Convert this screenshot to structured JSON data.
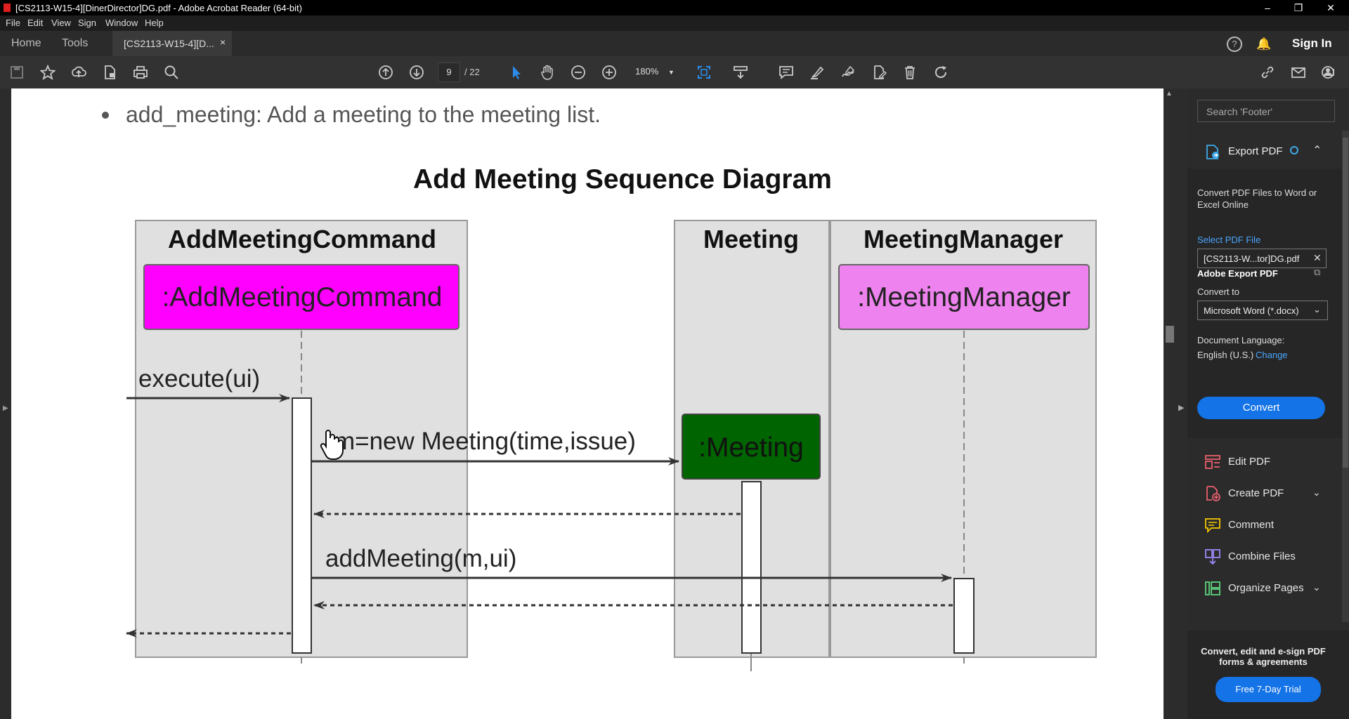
{
  "window": {
    "title": "[CS2113-W15-4][DinerDirector]DG.pdf - Adobe Acrobat Reader (64-bit)"
  },
  "menu": [
    "File",
    "Edit",
    "View",
    "Sign",
    "Window",
    "Help"
  ],
  "tabs": {
    "home": "Home",
    "tools": "Tools",
    "doc": "[CS2113-W15-4][D...",
    "close": "×",
    "signin": "Sign In",
    "help": "?"
  },
  "toolbar": {
    "page_current": "9",
    "page_total": "/ 22",
    "zoom": "180%",
    "icons": [
      "save-icon",
      "star-icon",
      "upload-icon",
      "file-icon",
      "print-icon",
      "search-icon",
      "page-up-icon",
      "page-down-icon",
      "select-icon",
      "hand-icon",
      "zoom-out-icon",
      "zoom-in-icon",
      "fit-icon",
      "scroll-icon",
      "comment-icon",
      "highlight-icon",
      "sign-icon",
      "edit-icon",
      "delete-icon",
      "rotate-icon",
      "link-icon",
      "email-icon",
      "share-icon"
    ]
  },
  "document": {
    "bullet_text": "add_meeting: Add a meeting to the meeting list.",
    "diagram": {
      "title": "Add Meeting Sequence Diagram",
      "participants": [
        {
          "header": "AddMeetingCommand",
          "box": ":AddMeetingCommand",
          "color": "#ff00ff"
        },
        {
          "header": "Meeting",
          "box": ":Meeting",
          "color": "#006400"
        },
        {
          "header": "MeetingManager",
          "box": ":MeetingManager",
          "color": "#ee82ee"
        }
      ],
      "messages": [
        "execute(ui)",
        "m=new Meeting(time,issue)",
        "addMeeting(m,ui)"
      ]
    }
  },
  "right_pane": {
    "search_placeholder": "Search 'Footer'",
    "export_label": "Export PDF",
    "card_title": "Adobe Export PDF",
    "card_desc": "Convert PDF Files to Word or Excel Online",
    "select_file": "Select PDF File",
    "file_name": "[CS2113-W...tor]DG.pdf",
    "convert_to": "Convert to",
    "format": "Microsoft Word (*.docx)",
    "doc_lang_label": "Document Language:",
    "doc_lang": "English (U.S.)",
    "change": "Change",
    "convert_btn": "Convert",
    "tools": [
      {
        "label": "Edit PDF",
        "color": "#e8606e"
      },
      {
        "label": "Create PDF",
        "color": "#e8606e",
        "chevron": true
      },
      {
        "label": "Comment",
        "color": "#f5c800"
      },
      {
        "label": "Combine Files",
        "color": "#9d87f5"
      },
      {
        "label": "Organize Pages",
        "color": "#5ed37c",
        "chevron": true
      }
    ],
    "promo_text": "Convert, edit and e-sign PDF forms & agreements",
    "trial_btn": "Free 7-Day Trial"
  }
}
